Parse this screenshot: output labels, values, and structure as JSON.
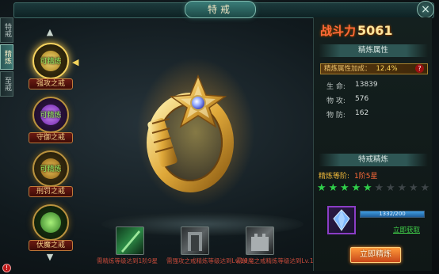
{
  "window": {
    "title": "特戒",
    "close_label": "×"
  },
  "side_tabs": [
    {
      "label": "特戒",
      "active": false
    },
    {
      "label": "精炼",
      "active": true
    },
    {
      "label": "至戒",
      "active": false
    }
  ],
  "rings": [
    {
      "tag": "可精炼",
      "label": "强攻之戒",
      "color": "#e5c23d"
    },
    {
      "tag": "可精炼",
      "label": "守御之戒",
      "color": "#9c47d9"
    },
    {
      "tag": "可精炼",
      "label": "刑罚之戒",
      "color": "#d8a632"
    },
    {
      "tag": "",
      "label": "伏魔之戒",
      "color": "#5ab24a"
    }
  ],
  "nav": {
    "up": "▲",
    "down": "▼",
    "selected_marker": "◀"
  },
  "skills": [
    {
      "text": "需精炼等级达到1阶9星",
      "color": "#6cc76b"
    },
    {
      "text": "需强攻之戒精炼等级达到Lv.10",
      "color": "#8b8f92"
    },
    {
      "text": "需伏魔之戒精炼等级达到Lv.10",
      "color": "#a4a8aa"
    }
  ],
  "right": {
    "power_label": "战斗力",
    "power_value": "5061",
    "refine_attr_header": "精炼属性",
    "bonus_label": "精炼属性加成：",
    "bonus_value": "12.4%",
    "bonus_help": "?",
    "stats": [
      {
        "label": "生 命:",
        "value": "13839"
      },
      {
        "label": "物 攻:",
        "value": "576"
      },
      {
        "label": "物 防:",
        "value": "162"
      }
    ],
    "refine_section_header": "特戒精炼",
    "level_label": "精炼等阶:",
    "level_value": "1阶5星",
    "stars_total": 10,
    "stars_lit": 5,
    "material_progress_text": "1332/200",
    "material_progress_fraction": 1.0,
    "acquire_link": "立即获取",
    "refine_button": "立即精炼"
  },
  "alert_badge": "!"
}
